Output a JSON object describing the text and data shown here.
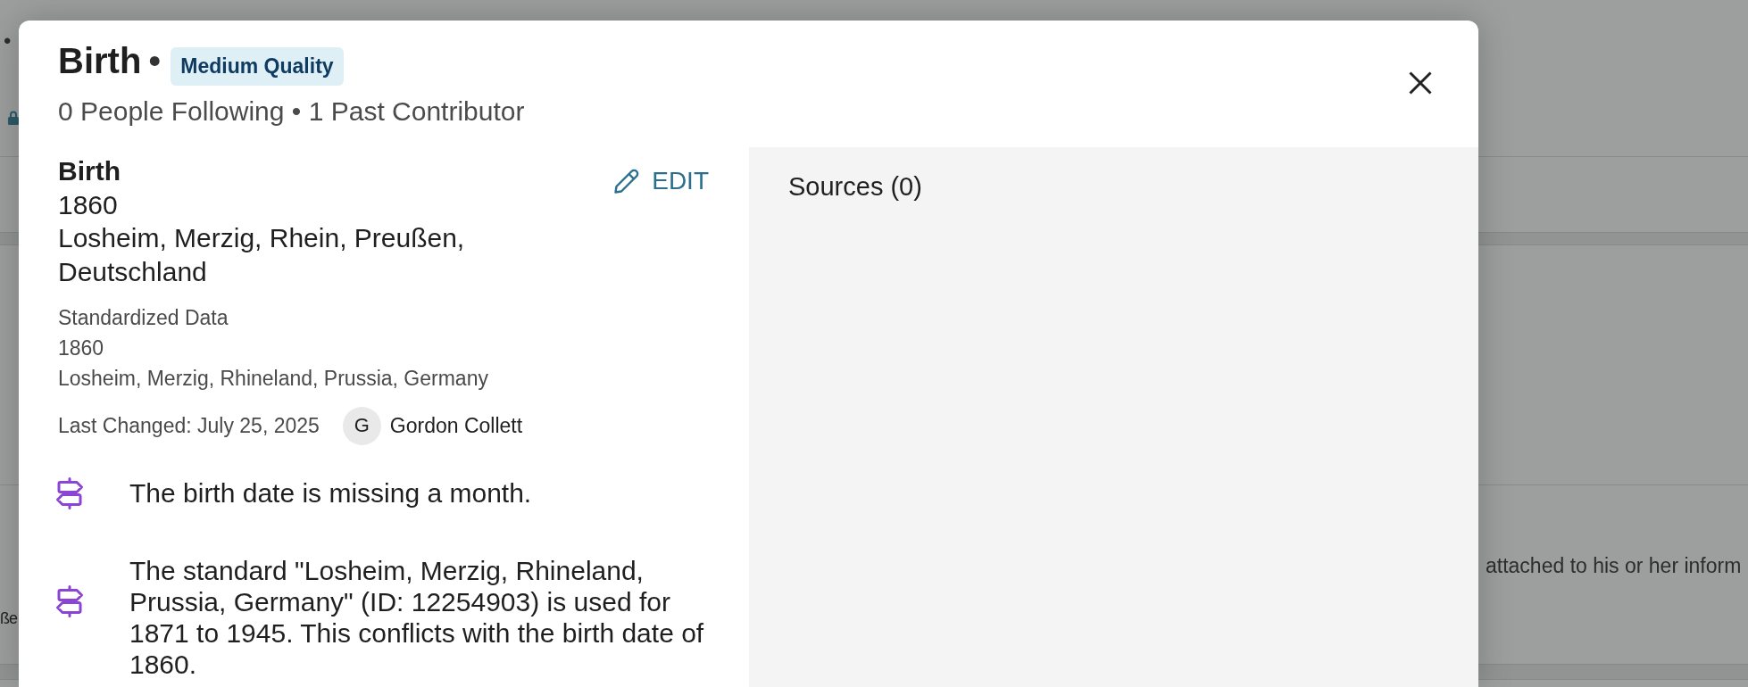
{
  "background_page": {
    "bullet": "•",
    "text_right": "attached to his or her inform",
    "text_left": "ße"
  },
  "dialog": {
    "title": "Birth",
    "separator": "•",
    "quality_badge": "Medium Quality",
    "subtitle": "0 People Following • 1 Past Contributor",
    "event": {
      "label": "Birth",
      "date": "1860",
      "place": "Losheim, Merzig, Rhein, Preußen, Deutschland",
      "edit_button": "EDIT"
    },
    "standardized": {
      "heading": "Standardized Data",
      "date": "1860",
      "place": "Losheim, Merzig, Rhineland, Prussia, Germany"
    },
    "last_changed": {
      "text": "Last Changed: July 25, 2025",
      "contributor_initial": "G",
      "contributor_name": "Gordon Collett"
    },
    "warnings": [
      {
        "text": "The birth date is missing a month."
      },
      {
        "text": "The standard \"Losheim, Merzig, Rhineland, Prussia, Germany\" (ID: 12254903) is used for 1871 to 1945. This conflicts with the birth date of 1860."
      }
    ],
    "sources": {
      "heading": "Sources (0)"
    }
  }
}
